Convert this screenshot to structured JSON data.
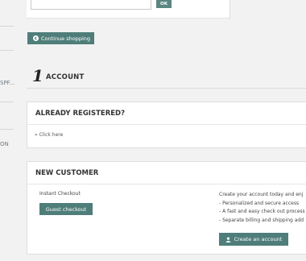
{
  "sidebar": {
    "truncated_text": "SPF...",
    "link_text": "ON"
  },
  "top": {
    "ok_label": "OK"
  },
  "nav": {
    "continue_label": "Continue shopping"
  },
  "account_step": {
    "number": "1",
    "title": "ACCOUNT"
  },
  "registered": {
    "heading": "ALREADY REGISTERED?",
    "link": "» Click here"
  },
  "new_customer": {
    "heading": "NEW CUSTOMER",
    "instant_label": "Instant Checkout",
    "guest_button": "Guest checkout",
    "benefits": [
      "Create your account today and enj",
      "- Personalized and secure access",
      "- A fast and easy check out process",
      "- Separate billing and shipping add"
    ],
    "create_button": "Create an account"
  },
  "icons": {
    "continue": "chevron-left-icon",
    "create": "user-icon"
  },
  "colors": {
    "accent": "#4f7e7a",
    "background": "#f2f2f2"
  }
}
